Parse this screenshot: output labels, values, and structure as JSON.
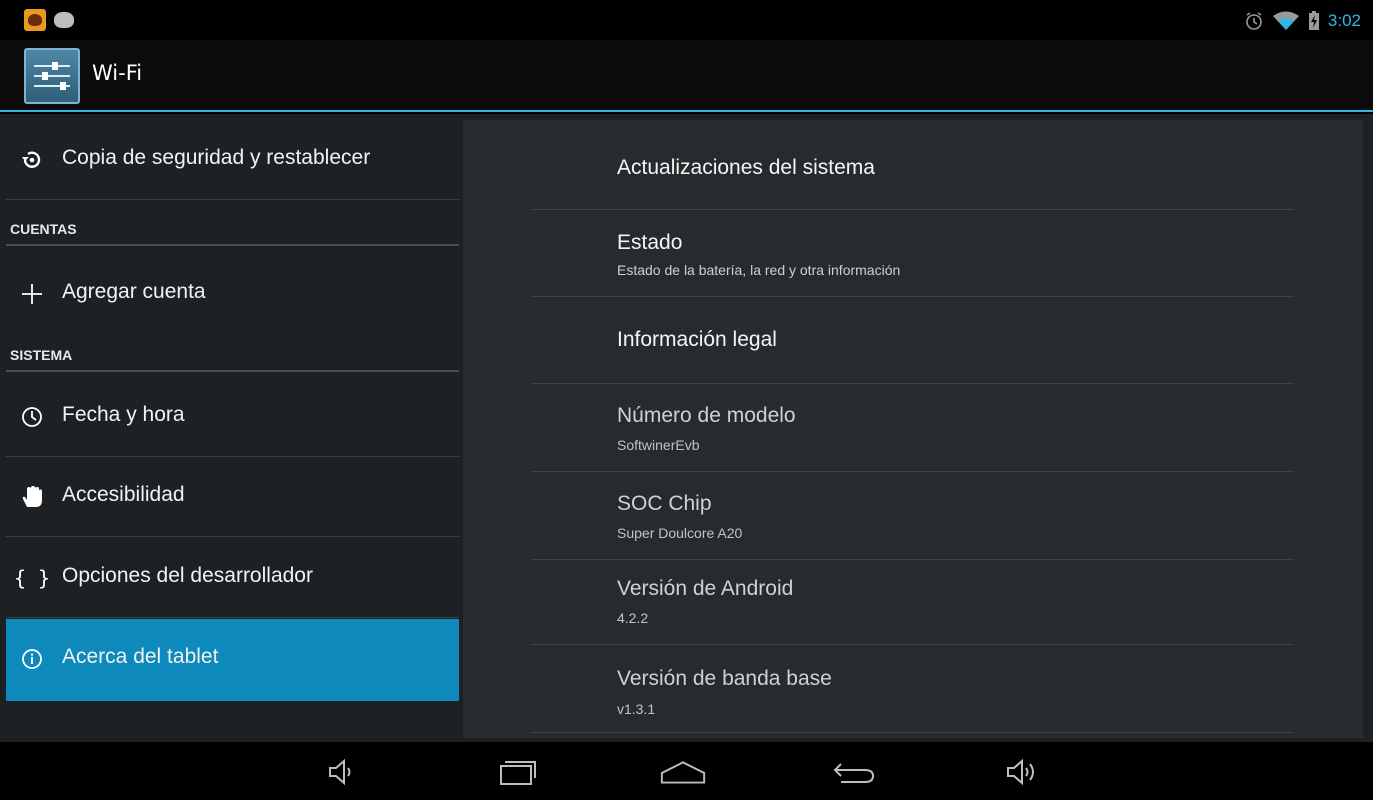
{
  "status_bar": {
    "notification_icons": [
      "notification-app-icon",
      "android-notification-icon"
    ],
    "status_icons": [
      "alarm-icon",
      "wifi-icon",
      "battery-charging-icon"
    ],
    "clock": "3:02",
    "accent_color": "#33b5e5"
  },
  "action_bar": {
    "app_icon": "settings-sliders-icon",
    "title": "Wi-Fi"
  },
  "left_pane": {
    "items_top": [
      {
        "icon": "backup-restore-icon",
        "label": "Copia de seguridad y restablecer"
      }
    ],
    "section_cuentas": "CUENTAS",
    "items_cuentas": [
      {
        "icon": "plus-icon",
        "label": "Agregar cuenta"
      }
    ],
    "section_sistema": "SISTEMA",
    "items_sistema": [
      {
        "icon": "clock-icon",
        "label": "Fecha y hora"
      },
      {
        "icon": "hand-icon",
        "label": "Accesibilidad"
      },
      {
        "icon": "braces-icon",
        "label": "Opciones del desarrollador"
      },
      {
        "icon": "info-icon",
        "label": "Acerca del tablet",
        "selected": true
      }
    ],
    "selected_color": "#0d89bb"
  },
  "right_pane": {
    "items": [
      {
        "title": "Actualizaciones del sistema",
        "summary": "",
        "enabled": true
      },
      {
        "title": "Estado",
        "summary": "Estado de la batería, la red y otra información",
        "enabled": true
      },
      {
        "title": "Información legal",
        "summary": "",
        "enabled": true
      },
      {
        "title": "Número de modelo",
        "summary": "SoftwinerEvb",
        "enabled": false
      },
      {
        "title": "SOC Chip",
        "summary": "Super Doulcore A20",
        "enabled": false
      },
      {
        "title": "Versión de Android",
        "summary": "4.2.2",
        "enabled": false
      },
      {
        "title": "Versión de banda base",
        "summary": "v1.3.1",
        "enabled": false
      }
    ]
  },
  "nav_bar": {
    "buttons": [
      "volume-down-icon",
      "recent-apps-icon",
      "home-icon",
      "back-icon",
      "volume-up-icon"
    ]
  }
}
